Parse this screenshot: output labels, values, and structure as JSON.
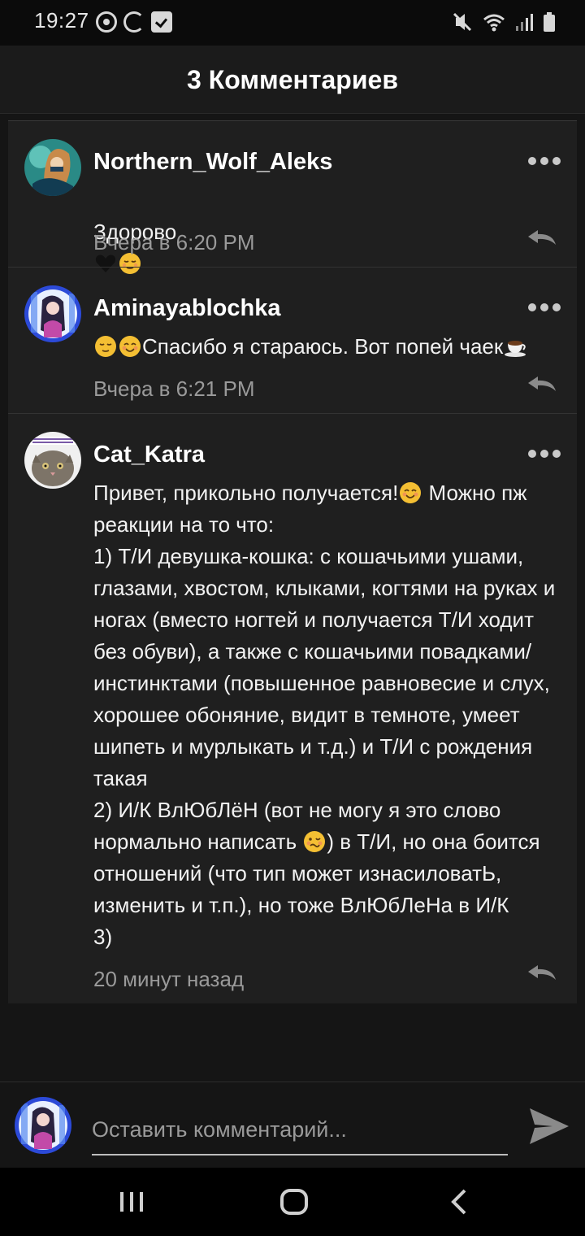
{
  "status_bar": {
    "time": "19:27",
    "left_icons": [
      "record-icon",
      "sync-icon",
      "checkbox-icon"
    ],
    "right_icons": [
      "mute-icon",
      "wifi-icon",
      "signal-icon",
      "battery-icon"
    ]
  },
  "header": {
    "title": "3 Комментариев"
  },
  "comments": [
    {
      "username": "Northern_Wolf_Aleks",
      "text": "Здорово",
      "emojis_after": [
        "black-heart-emoji",
        "relieved-face-emoji"
      ],
      "timestamp": "Вчера в 6:20 PM"
    },
    {
      "username": "Aminayablochka",
      "emojis_before": [
        "relieved-face-emoji",
        "smiling-face-emoji"
      ],
      "text": "Спасибо я стараюсь. Вот попей чаек",
      "emojis_after": [
        "hot-beverage-emoji"
      ],
      "timestamp": "Вчера в 6:21 PM"
    },
    {
      "username": "Cat_Katra",
      "text_part1": "Привет, прикольно получается!",
      "text_part2": " Можно пж реакции на то что:\n1) Т/И девушка-кошка: с кошачьими ушами, глазами, хвостом, клыками, когтями на руках и ногах (вместо ногтей и получается Т/И ходит без обуви), а также с кошачьими повадками/инстинктами (повышенное равновесие и слух, хорошее обоняние, видит в темноте, умеет шипеть и мурлыкать и т.д.) и Т/И с рождения такая\n2) И/К ВлЮбЛёН (вот не могу я это слово нормально написать ",
      "text_part3": ") в Т/И, но она боится отношений (что тип может изнасиловатЬ, изменить и т.п.), но тоже ВлЮбЛеНа в И/К\n3)",
      "timestamp": "20 минут назад"
    }
  ],
  "composer": {
    "placeholder": "Оставить комментарий..."
  },
  "colors": {
    "background": "#151515",
    "card": "#1f1f1f",
    "timestamp": "#9a9a9a",
    "emoji": "#f4bf33"
  }
}
